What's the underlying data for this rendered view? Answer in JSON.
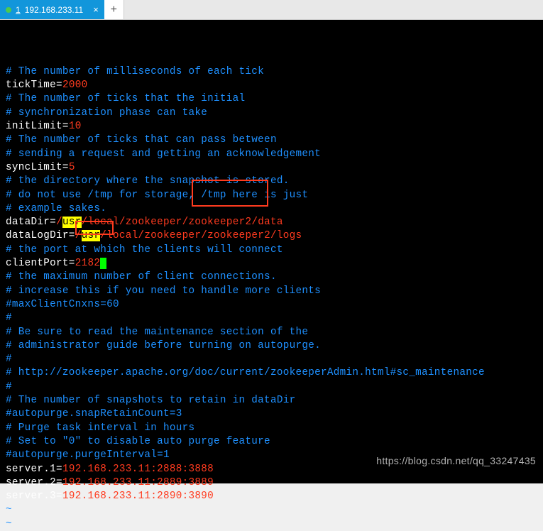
{
  "tabs": {
    "active": {
      "index": "1",
      "label": "192.168.233.11",
      "close": "×"
    },
    "add": "+"
  },
  "lines": {
    "l1": "# The number of milliseconds of each tick",
    "l2a": "tickTime",
    "l2eq": "=",
    "l2b": "2000",
    "l3": "# The number of ticks that the initial",
    "l4": "# synchronization phase can take",
    "l5a": "initLimit",
    "l5eq": "=",
    "l5b": "10",
    "l6": "# The number of ticks that can pass between",
    "l7": "# sending a request and getting an acknowledgement",
    "l8a": "syncLimit",
    "l8eq": "=",
    "l8b": "5",
    "l9": "# the directory where the snapshot is stored.",
    "l10": "# do not use /tmp for storage, /tmp here is just",
    "l11": "# example sakes.",
    "l12a": "dataDir",
    "l12eq": "=",
    "l12r1": "/",
    "l12usr": "usr",
    "l12r2": "/local/zookeeper/zookeeper2/data",
    "l13a": "dataLogDir",
    "l13eq": "=",
    "l13r1": "/",
    "l13usr": "usr",
    "l13r2": "/local/zookeeper/zookeeper2/logs",
    "l14": "# the port at which the clients will connect",
    "l15a": "clientPort",
    "l15eq": "=",
    "l15b": "2182",
    "l16": "# the maximum number of client connections.",
    "l17": "# increase this if you need to handle more clients",
    "l18": "#maxClientCnxns=60",
    "l19": "#",
    "l20": "# Be sure to read the maintenance section of the",
    "l21": "# administrator guide before turning on autopurge.",
    "l22": "#",
    "l23": "# http://zookeeper.apache.org/doc/current/zookeeperAdmin.html#sc_maintenance",
    "l24": "#",
    "l25": "# The number of snapshots to retain in dataDir",
    "l26": "#autopurge.snapRetainCount=3",
    "l27": "# Purge task interval in hours",
    "l28": "# Set to \"0\" to disable auto purge feature",
    "l29": "#autopurge.purgeInterval=1",
    "l30a": "server.1",
    "l30eq": "=",
    "l30b": "192.168.233.11:2888:3888",
    "l31a": "server.2",
    "l31eq": "=",
    "l31b": "192.168.233.11:2889:3889",
    "l32a": "server.3",
    "l32eq": "=",
    "l32b": "192.168.233.11:2890:3890",
    "tilde": "~"
  },
  "watermark": "https://blog.csdn.net/qq_33247435"
}
